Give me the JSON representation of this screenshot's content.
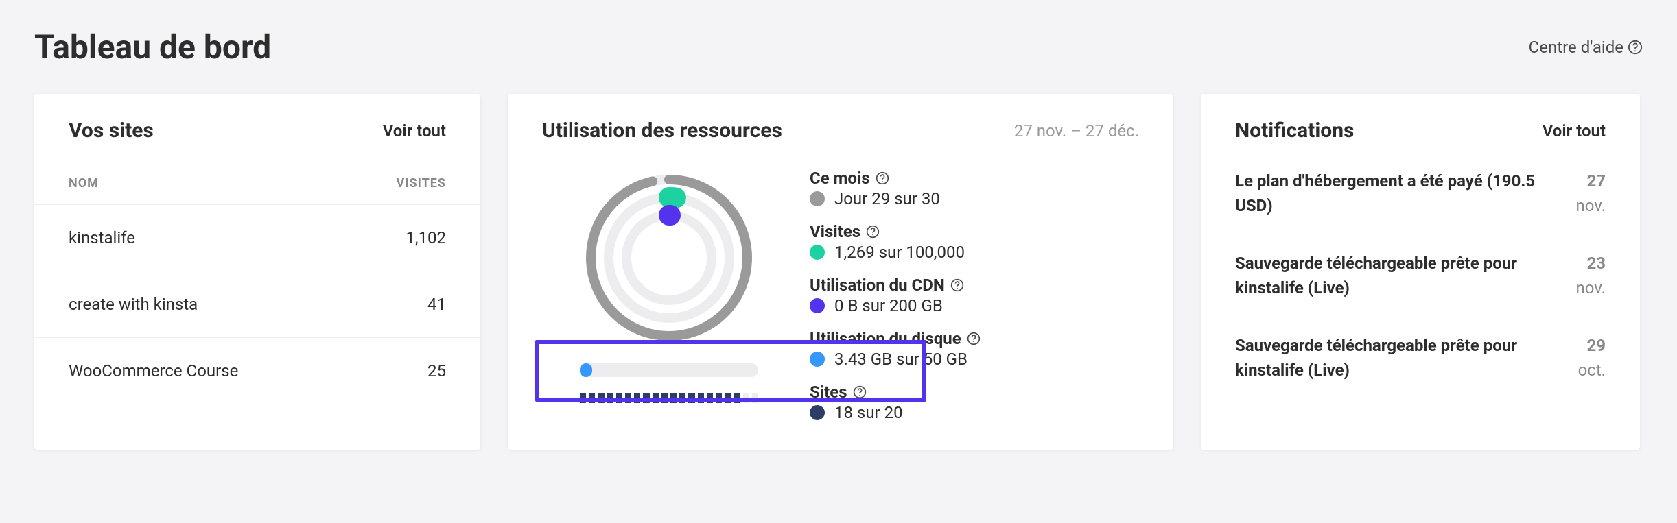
{
  "header": {
    "title": "Tableau de bord",
    "help_label": "Centre d'aide"
  },
  "sites": {
    "title": "Vos sites",
    "view_all": "Voir tout",
    "col_name": "NOM",
    "col_visits": "VISITES",
    "rows": [
      {
        "name": "kinstalife",
        "visits": "1,102"
      },
      {
        "name": "create with kinsta",
        "visits": "41"
      },
      {
        "name": "WooCommerce Course",
        "visits": "25"
      }
    ]
  },
  "resources": {
    "title": "Utilisation des ressources",
    "date_range": "27 nov. – 27 déc.",
    "items": {
      "month": {
        "label": "Ce mois",
        "value": "Jour 29 sur 30",
        "color": "#9a9a9a"
      },
      "visits": {
        "label": "Visites",
        "value": "1,269 sur 100,000",
        "color": "#1dd1a1"
      },
      "cdn": {
        "label": "Utilisation du CDN",
        "value": "0 B sur 200 GB",
        "color": "#5333ed"
      },
      "disk": {
        "label": "Utilisation du disque",
        "value": "3.43 GB sur 50 GB",
        "color": "#3498ff"
      },
      "sites": {
        "label": "Sites",
        "value": "18 sur 20",
        "color": "#2c3e68"
      }
    }
  },
  "notifications": {
    "title": "Notifications",
    "view_all": "Voir tout",
    "items": [
      {
        "text": "Le plan d'hébergement a été payé (190.5 USD)",
        "day": "27",
        "month": "nov."
      },
      {
        "text": "Sauvegarde téléchargeable prête pour kinstalife (Live)",
        "day": "23",
        "month": "nov."
      },
      {
        "text": "Sauvegarde téléchargeable prête pour kinstalife (Live)",
        "day": "29",
        "month": "oct."
      }
    ]
  },
  "chart_data": {
    "type": "donut",
    "rings": [
      {
        "name": "Ce mois",
        "value": 29,
        "max": 30,
        "color": "#9a9a9a"
      },
      {
        "name": "Visites",
        "value": 1269,
        "max": 100000,
        "color": "#1dd1a1"
      },
      {
        "name": "Utilisation du CDN",
        "value": 0,
        "max": 200,
        "unit": "GB",
        "color": "#5333ed"
      }
    ],
    "disk_bar": {
      "value": 3.43,
      "max": 50,
      "unit": "GB",
      "color": "#3498ff"
    },
    "sites_dash": {
      "value": 18,
      "max": 20,
      "color": "#2c3e68"
    }
  }
}
